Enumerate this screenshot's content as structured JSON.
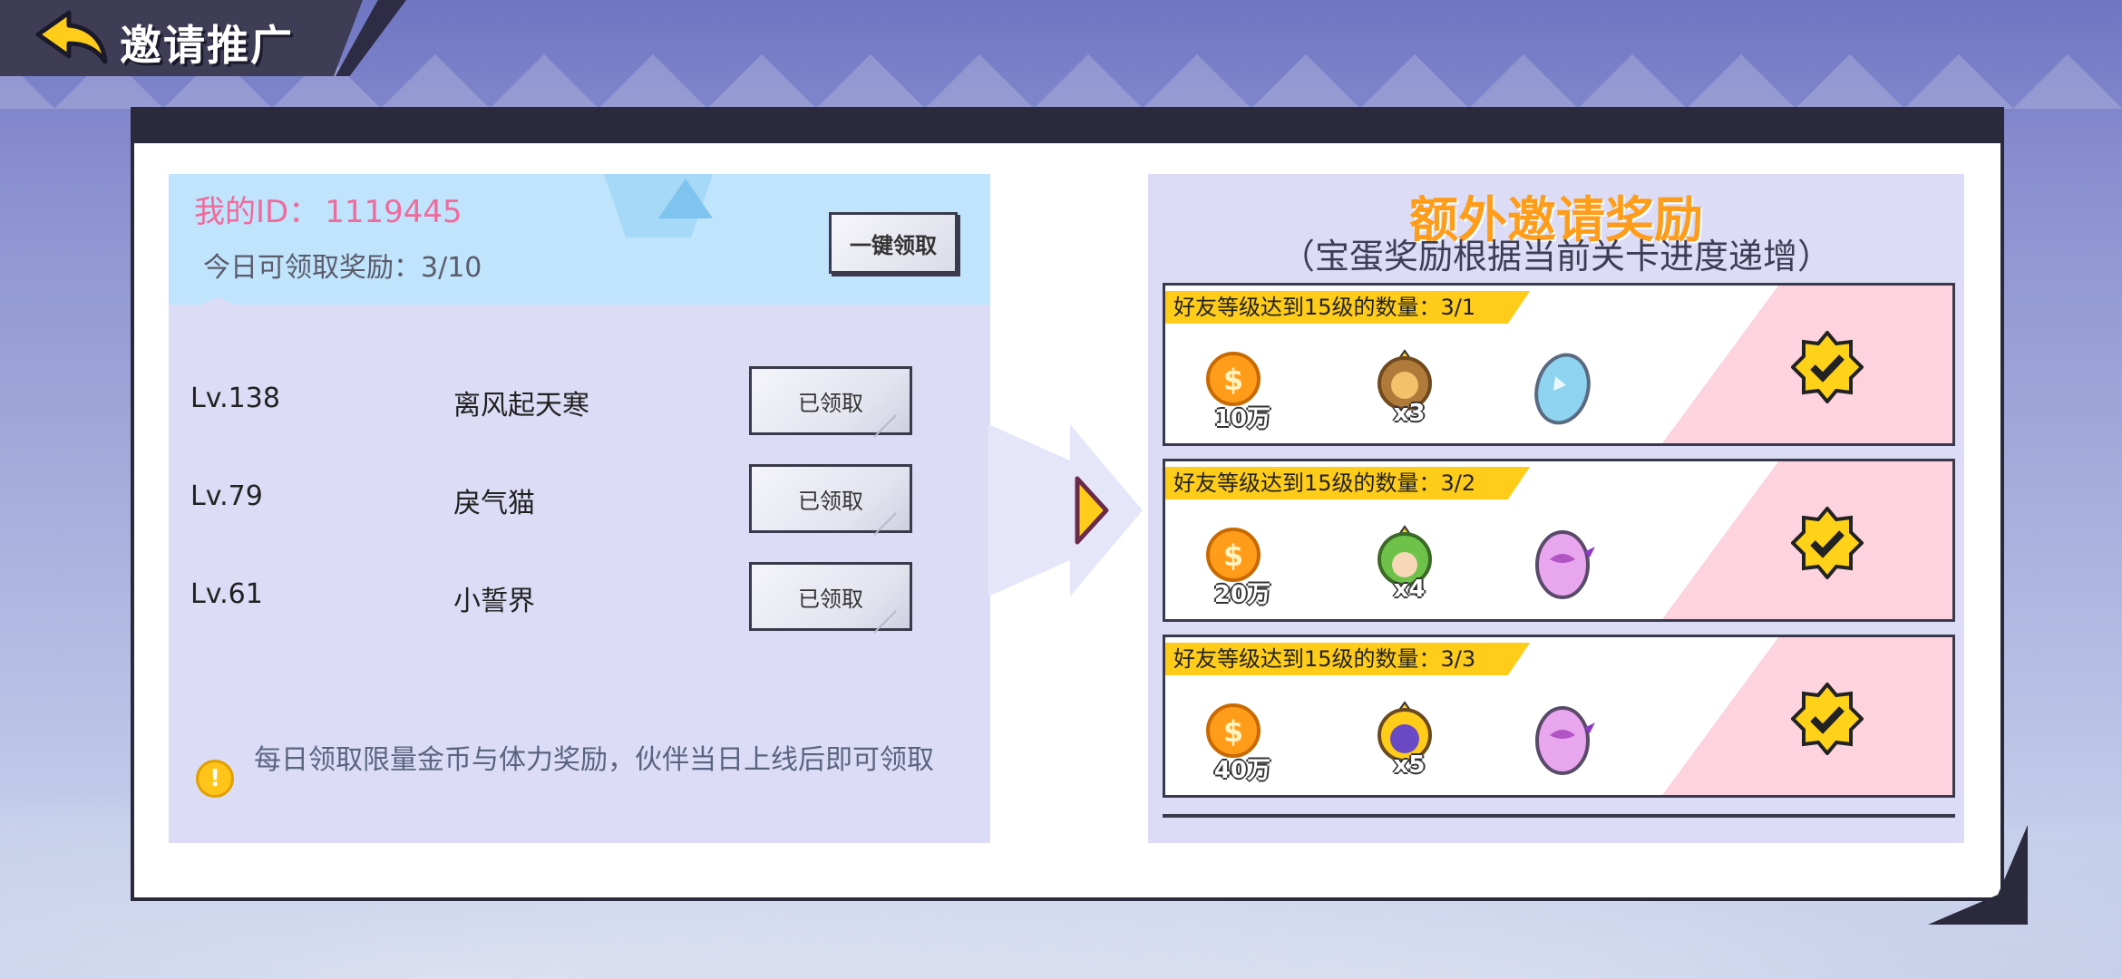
{
  "header": {
    "title": "邀请推广",
    "back_icon": "back-arrow-icon"
  },
  "left": {
    "my_id_label": "我的ID：",
    "my_id_value": "1119445",
    "today_reward": "今日可领取奖励：3/10",
    "claim_all_label": "一键领取",
    "friends": [
      {
        "level": "Lv.138",
        "name": "离风起天寒",
        "button": "已领取"
      },
      {
        "level": "Lv.79",
        "name": "戾气猫",
        "button": "已领取"
      },
      {
        "level": "Lv.61",
        "name": "小誓界",
        "button": "已领取"
      }
    ],
    "note": "每日领取限量金币与体力奖励，伙伴当日上线后即可领取",
    "note_icon": "exclamation-icon"
  },
  "right": {
    "title": "额外邀请奖励",
    "subtitle": "（宝蛋奖励根据当前关卡进度递增）",
    "rewards": [
      {
        "condition": "好友等级达到15级的数量：3/1",
        "coin": "10万",
        "hero_qty": "x3",
        "egg": "blue-egg-icon",
        "hero": "lion-hero-icon",
        "claimed": true
      },
      {
        "condition": "好友等级达到15级的数量：3/2",
        "coin": "20万",
        "hero_qty": "x4",
        "egg": "purple-egg-icon",
        "hero": "green-hair-hero-icon",
        "claimed": true
      },
      {
        "condition": "好友等级达到15级的数量：3/3",
        "coin": "40万",
        "hero_qty": "x5",
        "egg": "purple-egg-icon",
        "hero": "purple-bird-hero-icon",
        "claimed": true
      }
    ]
  },
  "colors": {
    "accent_orange": "#ff9d1a",
    "id_pink": "#f06a9c",
    "banner_yellow": "#ffcc1a",
    "panel_dark": "#2b2a3c"
  }
}
